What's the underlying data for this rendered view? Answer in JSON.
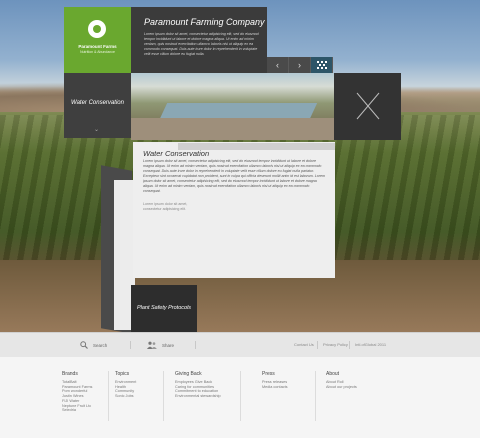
{
  "header": {
    "logo_name": "Paramount Farms",
    "logo_tagline": "Nutrition & Abundance",
    "intro_title": "Paramount Farming Company",
    "intro_text": "Lorem ipsum dolor sit amet, consectetur adipisicing elit, sed do eiusmod tempor incididunt ut labore et dolore magna aliqua. Ut enim ad minim veniam, quis nostrud exercitation ullamco laboris nisi ut aliquip ex ea commodo consequat. Duis aute irure dolor in reprehenderit in voluptate velit esse cillum dolore eu fugiat nulla.",
    "prev_arrow": "‹",
    "next_arrow": "›",
    "grid_icon": "grid-icon"
  },
  "sidebar": {
    "label": "Water Conservation",
    "chevron": "⌄"
  },
  "content": {
    "title": "Water Conservation",
    "body": "Lorem ipsum dolor sit amet, consectetur adipisicing elit, sed do eiusmod tempor incididunt ut labore et dolore magna aliqua. Ut enim ad minim veniam, quis nostrud exercitation ullamco laboris nisi ut aliquip ex ea commodo consequat. Duis aute irure dolor in reprehenderit in voluptate velit esse cillum dolore eu fugiat nulla pariatur. Excepteur sint occaecat cupidatat non proident, sunt in culpa qui officia deserunt mollit anim id est laborum. Lorem ipsum dolor sit amet, consectetur adipisicing elit, sed do eiusmod tempor incididunt ut labore et dolore magna aliqua. Ut enim ad minim veniam, quis nostrud exercitation ullamco laboris nisi ut aliquip ex ea commodo consequat.",
    "body_extra": "Lorem ipsum dolor sit amet, consectetur adipisicing elit."
  },
  "protocol": {
    "label": "Plant Safety Protocols"
  },
  "bar": {
    "search_label": "Search",
    "share_label": "Share",
    "links": [
      "Contact Us",
      "Privacy Policy",
      "Intl.ofGlobal 2011"
    ]
  },
  "footer": {
    "columns": [
      {
        "title": "Brands",
        "items": [
          "TotalBalt",
          "Paramount Farms",
          "Pom wonderful",
          "Justin Wines",
          "FIJI Water",
          "Neptune Fruit Ltc",
          "Seledria"
        ]
      },
      {
        "title": "Topics",
        "items": [
          "Environment",
          "Health",
          "Community",
          "Sonic Jobs"
        ]
      },
      {
        "title": "Giving Back",
        "items": [
          "Employees Give Back",
          "Caring for communities",
          "Commitment to education",
          "Environmental stewardship"
        ]
      },
      {
        "title": "Press",
        "items": [
          "Press releases",
          "Media contacts"
        ]
      },
      {
        "title": "About",
        "items": [
          "About Roll",
          "About our projects"
        ]
      }
    ]
  }
}
